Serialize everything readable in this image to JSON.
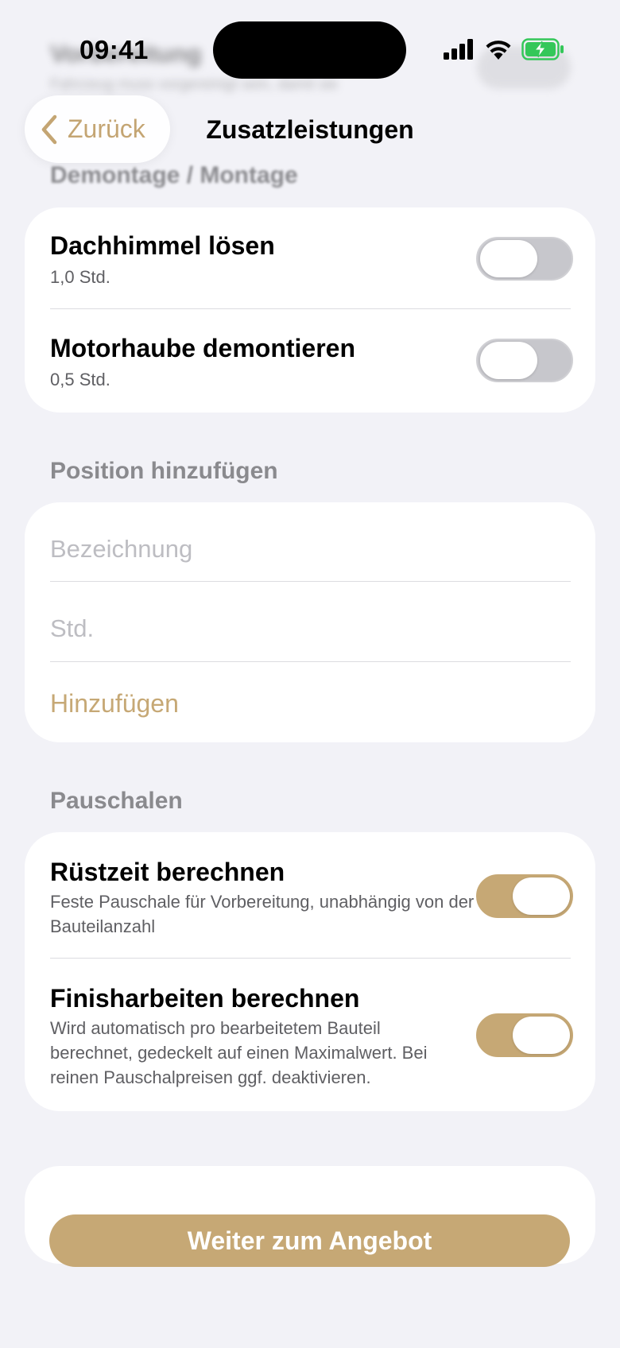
{
  "status_bar": {
    "time": "09:41"
  },
  "nav": {
    "back_label": "Zurück",
    "title": "Zusatzleistungen"
  },
  "background_blurred": {
    "title": "Vorbereitung",
    "subtitle": "Fahrzeug muss vorgereinigt sein, damit sie"
  },
  "sections": {
    "demontage": {
      "header": "Demontage / Montage",
      "items": [
        {
          "title": "Dachhimmel lösen",
          "subtitle": "1,0 Std.",
          "enabled": false
        },
        {
          "title": "Motorhaube demontieren",
          "subtitle": "0,5 Std.",
          "enabled": false
        }
      ]
    },
    "position": {
      "header": "Position hinzufügen",
      "name_placeholder": "Bezeichnung",
      "hours_placeholder": "Std.",
      "add_label": "Hinzufügen"
    },
    "pauschalen": {
      "header": "Pauschalen",
      "items": [
        {
          "title": "Rüstzeit berechnen",
          "subtitle": "Feste Pauschale für Vorbereitung, unabhängig von der Bauteilanzahl",
          "enabled": true
        },
        {
          "title": "Finisharbeiten berechnen",
          "subtitle": "Wird automatisch pro bearbeitetem Bauteil berechnet, gedeckelt auf einen Maximalwert. Bei reinen Pauschalpreisen ggf. deaktivieren.",
          "enabled": true
        }
      ]
    }
  },
  "cta": {
    "label": "Weiter zum Angebot"
  },
  "colors": {
    "accent": "#c6a875",
    "background": "#f2f2f7",
    "battery": "#34c759"
  }
}
